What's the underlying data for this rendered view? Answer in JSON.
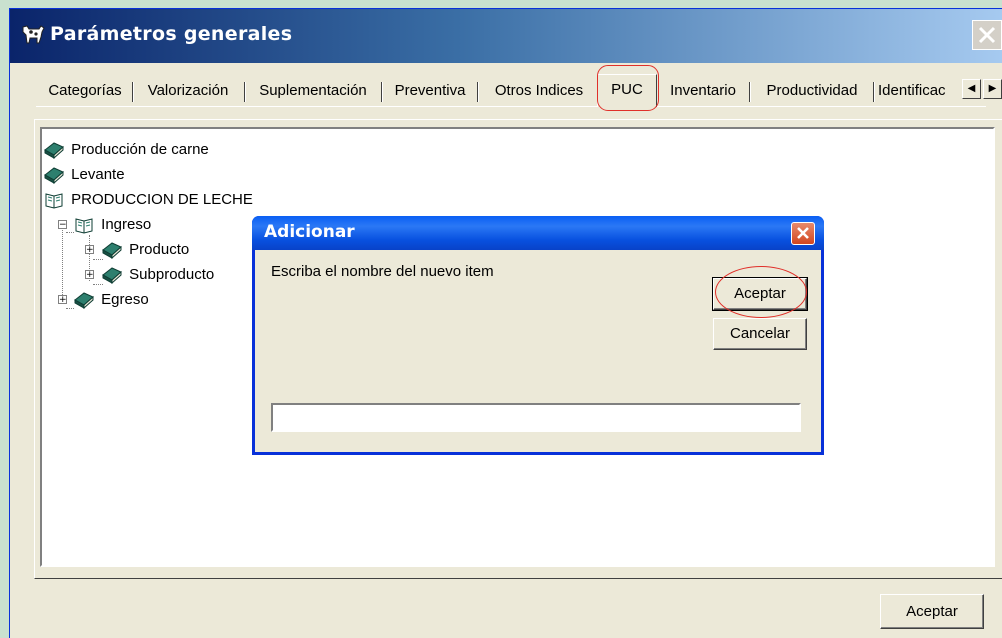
{
  "window": {
    "title": "Parámetros generales",
    "accent": "#0831d9"
  },
  "tabs": [
    {
      "label": "Categorías",
      "selected": false
    },
    {
      "label": "Valorización",
      "selected": false
    },
    {
      "label": "Suplementación",
      "selected": false
    },
    {
      "label": "Preventiva",
      "selected": false
    },
    {
      "label": "Otros Indices",
      "selected": false
    },
    {
      "label": "PUC",
      "selected": true
    },
    {
      "label": "Inventario",
      "selected": false
    },
    {
      "label": "Productividad",
      "selected": false
    },
    {
      "label": "Identificac",
      "selected": false
    }
  ],
  "tree": {
    "nodes": [
      {
        "label": "Producción de carne",
        "icon": "closed-book-icon"
      },
      {
        "label": "Levante",
        "icon": "closed-book-icon"
      },
      {
        "label": "PRODUCCION DE LECHE",
        "icon": "open-book-icon"
      },
      {
        "label": "Ingreso",
        "icon": "open-book-icon",
        "expander": "−"
      },
      {
        "label": "Producto",
        "icon": "closed-book-icon",
        "expander": "+"
      },
      {
        "label": "Subproducto",
        "icon": "closed-book-icon",
        "expander": "+"
      },
      {
        "label": "Egreso",
        "icon": "closed-book-icon",
        "expander": "+"
      }
    ]
  },
  "footer": {
    "ok_label": "Aceptar"
  },
  "dialog": {
    "title": "Adicionar",
    "prompt": "Escriba el nombre del nuevo item",
    "ok_label": "Aceptar",
    "cancel_label": "Cancelar",
    "input_value": ""
  },
  "highlight_color": "#e0302a"
}
